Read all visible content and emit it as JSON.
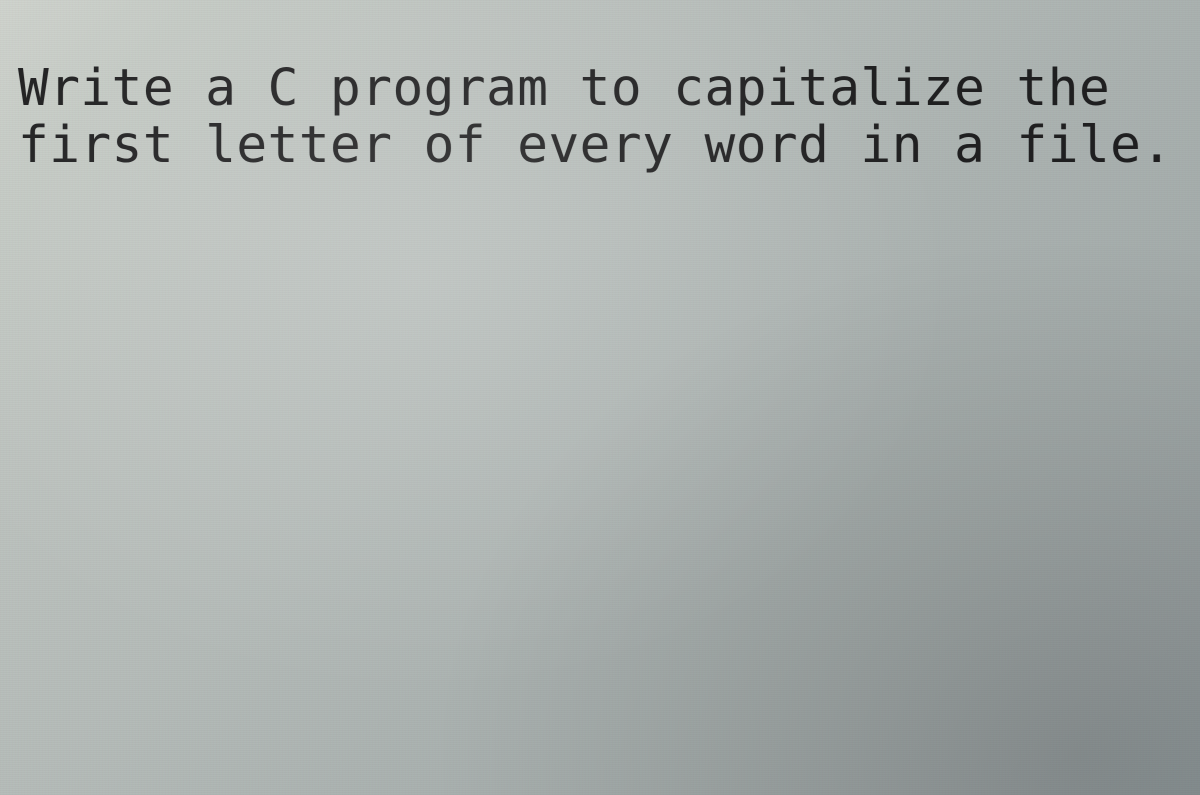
{
  "text": {
    "line1": "Write a C program to capitalize the",
    "line2": "first letter of every word in a file."
  }
}
